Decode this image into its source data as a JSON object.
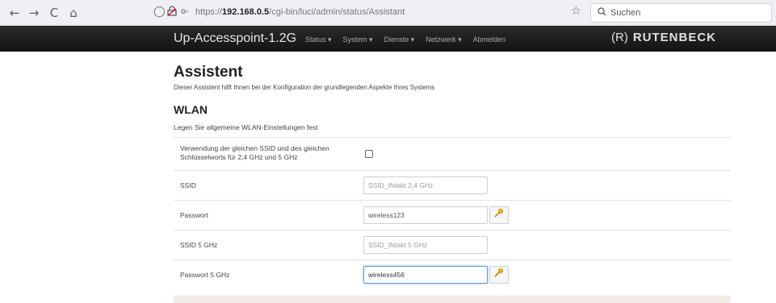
{
  "browser": {
    "back_icon": "←",
    "forward_icon": "→",
    "reload_icon": "C",
    "home_icon": "⌂",
    "shield_icon": "◯",
    "lock_icon": "🔒",
    "key_icon": "o-",
    "url_prefix": "https://",
    "url_host": "192.168.0.5",
    "url_path": "/cgi-bin/luci/admin/status/Assistant",
    "bookmark_icon": "☆",
    "search_placeholder": "Suchen"
  },
  "navbar": {
    "brand": "Up-Accesspoint-1.2G",
    "menu": [
      {
        "label": "Status ▾"
      },
      {
        "label": "System ▾"
      },
      {
        "label": "Dienste ▾"
      },
      {
        "label": "Netzwerk ▾"
      },
      {
        "label": "Abmelden"
      }
    ],
    "logo_mark": "(R)",
    "logo_text": "RUTENBECK"
  },
  "page": {
    "title": "Assistent",
    "description": "Dieser Assistent hilft Ihnen bei der Konfiguration der grundlegenden Aspekte Ihres Systems"
  },
  "wlan": {
    "title": "WLAN",
    "description": "Legen Sie allgemeine WLAN-Einstellungen fest",
    "same_ssid_label_line1": "Verwendung der gleichen SSID und des gleichen",
    "same_ssid_label_line2": "Schlüsselworts für 2,4 GHz und 5 GHz",
    "same_ssid_checked": false,
    "ssid_label": "SSID",
    "ssid_placeholder": "SSID_INtakt 2,4 GHz",
    "password_label": "Passwort",
    "password_value": "wireless123",
    "ssid5_label": "SSID 5 GHz",
    "ssid5_placeholder": "SSID_INtakt 5 GHz",
    "password5_label": "Passwort 5 GHz",
    "password5_value": "wireless456",
    "reveal_icon": "key-icon"
  },
  "colors": {
    "navbar_bg": "#1c1c1c",
    "focus_border": "#5b9bd5",
    "key_icon": "#e0a000"
  }
}
